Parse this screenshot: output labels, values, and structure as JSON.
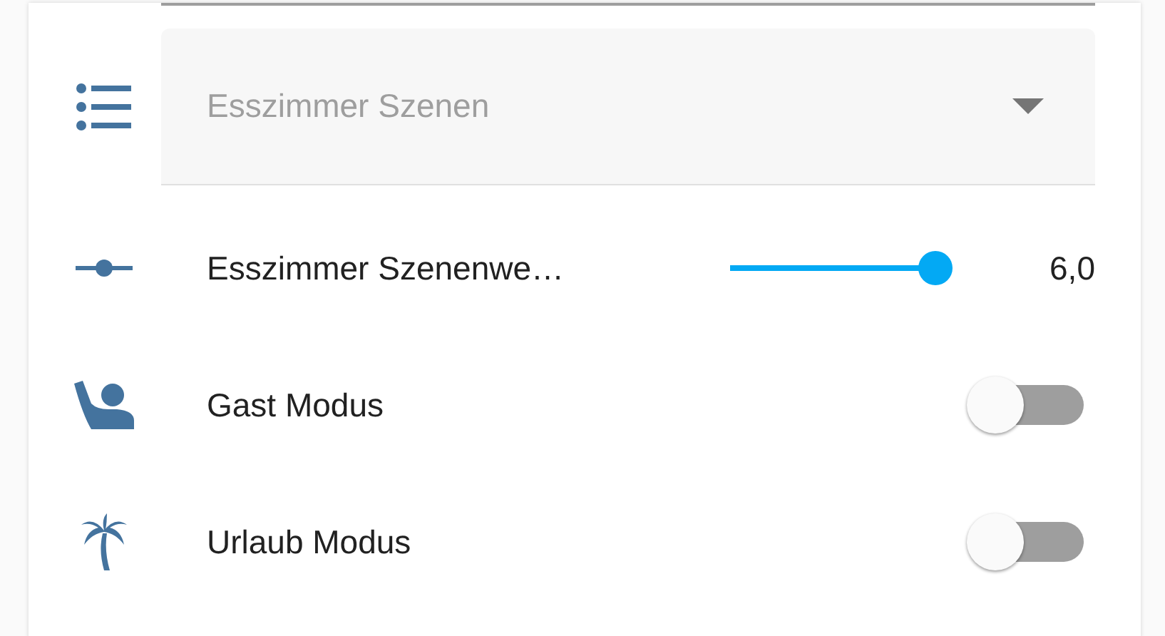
{
  "select": {
    "placeholder": "Esszimmer Szenen"
  },
  "rows": [
    {
      "kind": "slider",
      "label": "Esszimmer Szenenwe…",
      "level": 1.0,
      "reading": "6,0"
    },
    {
      "kind": "toggle",
      "label": "Gast Modus",
      "on": false
    },
    {
      "kind": "toggle",
      "label": "Urlaub Modus",
      "on": false
    }
  ]
}
